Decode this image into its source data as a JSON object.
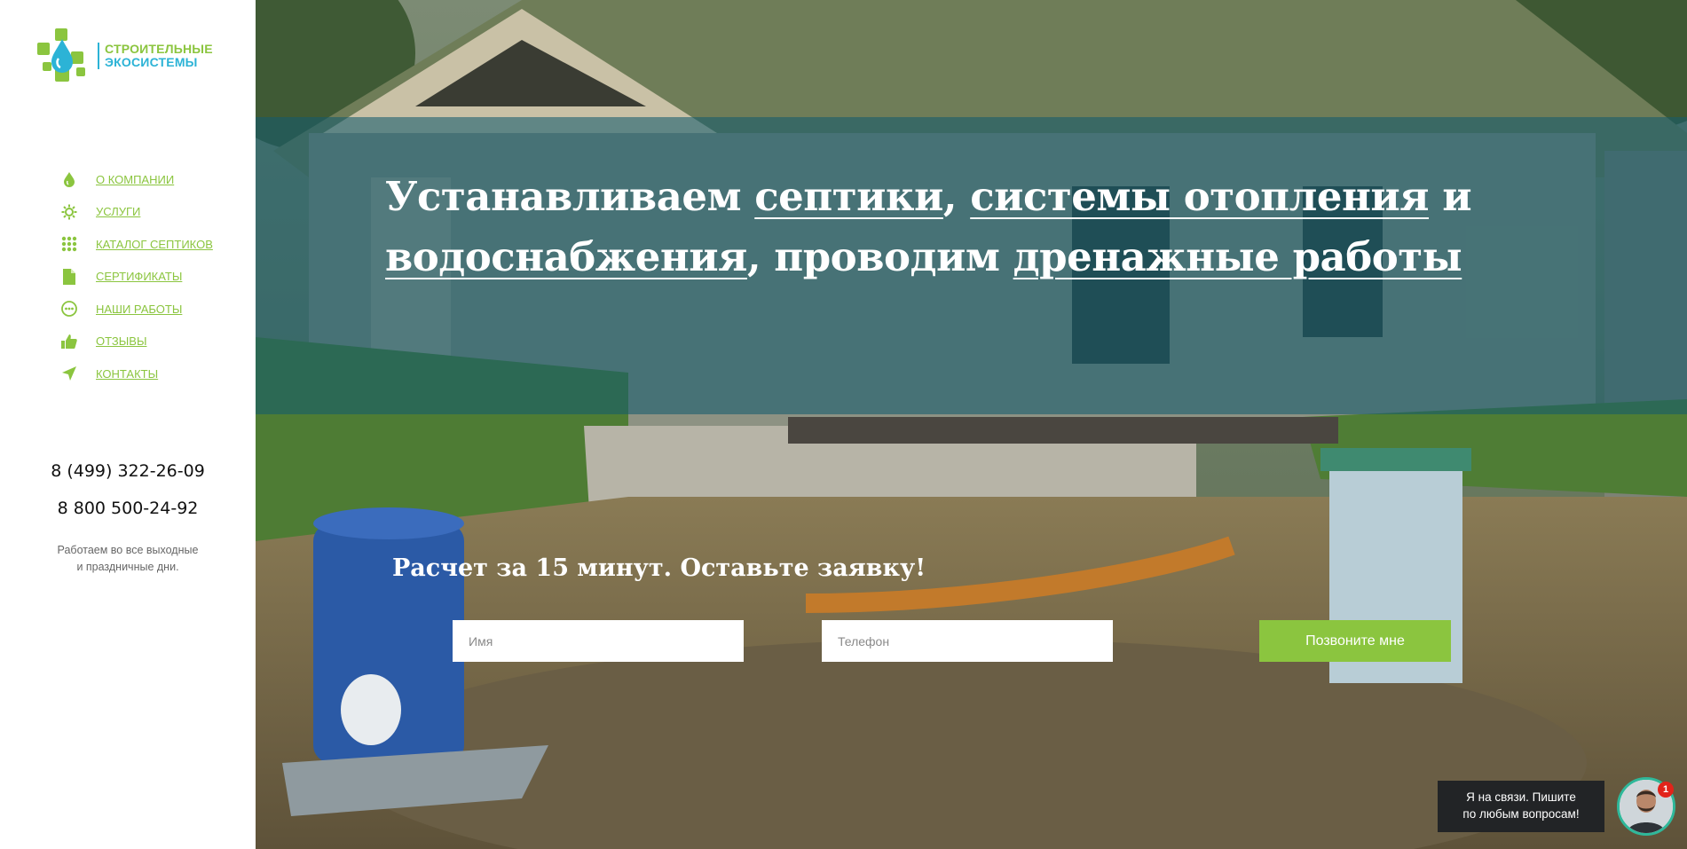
{
  "brand": {
    "line1": "СТРОИТЕЛЬНЫЕ",
    "line2": "ЭКОСИСТЕМЫ",
    "colors": {
      "green": "#8bc53f",
      "blue": "#2cb3d6"
    }
  },
  "nav": {
    "items": [
      {
        "label": "О КОМПАНИИ",
        "icon": "drop-icon"
      },
      {
        "label": "УСЛУГИ",
        "icon": "gear-icon"
      },
      {
        "label": "КАТАЛОГ СЕПТИКОВ",
        "icon": "grid-icon"
      },
      {
        "label": "СЕРТИФИКАТЫ",
        "icon": "document-icon"
      },
      {
        "label": "НАШИ РАБОТЫ",
        "icon": "chat-icon"
      },
      {
        "label": "ОТЗЫВЫ",
        "icon": "thumbs-up-icon"
      },
      {
        "label": "КОНТАКТЫ",
        "icon": "location-arrow-icon"
      }
    ]
  },
  "contacts": {
    "phone1": "8 (499) 322-26-09",
    "phone2": "8 800 500-24-92",
    "note_line1": "Работаем во все выходные",
    "note_line2": "и праздничные дни."
  },
  "hero": {
    "headline": {
      "w1": "Устанавливаем",
      "l1": "септики",
      "comma1": ",",
      "l2": "системы отопления",
      "w2": "и",
      "l3": "водоснабжения",
      "comma2": ",",
      "l4": "проводим",
      "l5": "дренажные работы"
    },
    "cta_title": "Расчет за 15 минут. Оставьте заявку!",
    "form": {
      "name_placeholder": "Имя",
      "phone_placeholder": "Телефон",
      "button_label": "Позвоните мне"
    }
  },
  "chat": {
    "line1": "Я на связи. Пишите",
    "line2": "по любым вопросам!",
    "badge": "1"
  }
}
